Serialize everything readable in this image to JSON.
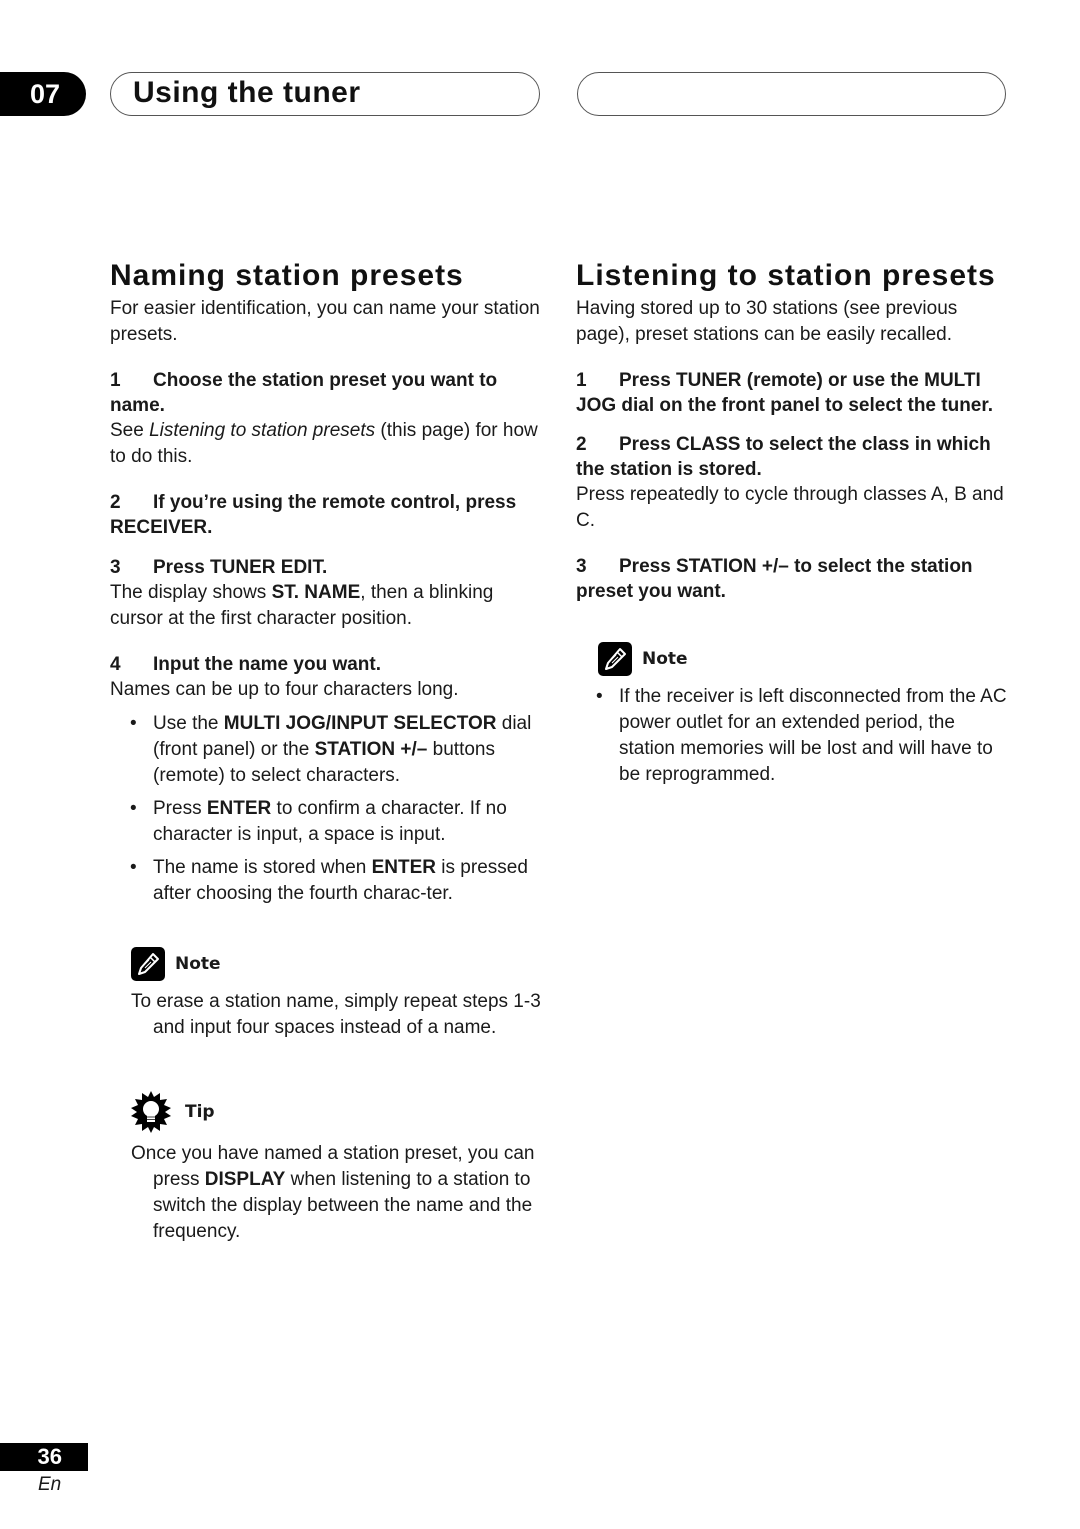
{
  "header": {
    "chapter_number": "07",
    "chapter_title": "Using the tuner",
    "right_pill_text": ""
  },
  "left": {
    "title": "Naming station presets",
    "intro": "For easier identification, you can name your station presets.",
    "steps": [
      {
        "num": "1",
        "heading_parts": [
          {
            "text": "Choose the station preset you want to name.",
            "bold": true
          }
        ],
        "body_parts": [
          {
            "text": "See ",
            "style": "normal"
          },
          {
            "text": "Listening to station presets",
            "style": "italic"
          },
          {
            "text": " (this page) for how to do this.",
            "style": "normal"
          }
        ]
      },
      {
        "num": "2",
        "heading": "If you’re using the remote control, press RECEIVER."
      },
      {
        "num": "3",
        "heading": "Press TUNER EDIT.",
        "body_parts": [
          {
            "text": "The display shows ",
            "style": "normal"
          },
          {
            "text": "ST. NAME",
            "style": "bold"
          },
          {
            "text": ", then a blinking cursor at the first character position.",
            "style": "normal"
          }
        ]
      },
      {
        "num": "4",
        "heading": "Input the name you want.",
        "body": "Names can be up to four characters long.",
        "bullets": [
          [
            {
              "text": "Use the ",
              "style": "normal"
            },
            {
              "text": "MULTI JOG/INPUT SELECTOR",
              "style": "bold"
            },
            {
              "text": " dial (front panel) or the ",
              "style": "normal"
            },
            {
              "text": "STATION +/–",
              "style": "bold"
            },
            {
              "text": " buttons (remote) to select characters.",
              "style": "normal"
            }
          ],
          [
            {
              "text": "Press ",
              "style": "normal"
            },
            {
              "text": "ENTER",
              "style": "bold"
            },
            {
              "text": " to confirm a character. If no character is input, a space is input.",
              "style": "normal"
            }
          ],
          [
            {
              "text": "The name is stored when ",
              "style": "normal"
            },
            {
              "text": "ENTER",
              "style": "bold"
            },
            {
              "text": " is pressed after choosing the fourth charac-ter.",
              "style": "normal"
            }
          ]
        ]
      }
    ],
    "note": {
      "label": "Note",
      "icon": "pencil-icon",
      "text": "To erase a station name, simply repeat steps 1-3 and input four spaces instead of a name."
    },
    "tip": {
      "label": "Tip",
      "icon": "lightbulb-icon",
      "parts": [
        {
          "text": "Once you have named a station preset, you can press ",
          "style": "normal"
        },
        {
          "text": "DISPLAY",
          "style": "bold"
        },
        {
          "text": " when listening to a station to switch the display between the name and the frequency.",
          "style": "normal"
        }
      ]
    }
  },
  "right": {
    "title": "Listening to station presets",
    "intro": "Having stored up to 30 stations (see previous page), preset stations can be easily recalled.",
    "steps": [
      {
        "num": "1",
        "heading": "Press TUNER (remote) or use the MULTI JOG dial on the front panel to select the tuner."
      },
      {
        "num": "2",
        "heading": "Press CLASS to select the class in which the station is stored.",
        "body": "Press repeatedly to cycle through classes A, B and C."
      },
      {
        "num": "3",
        "heading": "Press STATION +/– to select the station preset you want."
      }
    ],
    "note": {
      "label": "Note",
      "icon": "pencil-icon",
      "bullet": "If the receiver is left disconnected from the AC power outlet for an extended period, the station memories will be lost and will have to be reprogrammed."
    }
  },
  "footer": {
    "page_number": "36",
    "language": "En"
  }
}
